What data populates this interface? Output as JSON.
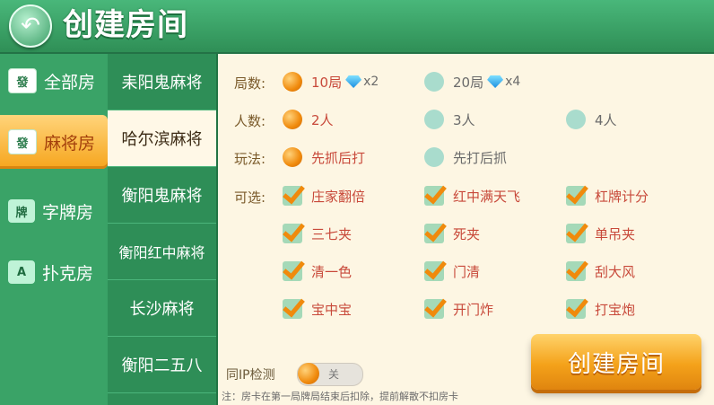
{
  "header": {
    "title": "创建房间",
    "back_icon": "back-arrow-icon"
  },
  "categories": [
    {
      "label": "全部房",
      "icon": "發",
      "active": false
    },
    {
      "label": "麻将房",
      "icon": "發",
      "active": true
    },
    {
      "label": "字牌房",
      "icon": "牌",
      "active": false
    },
    {
      "label": "扑克房",
      "icon": "A",
      "active": false
    }
  ],
  "games": [
    {
      "label": "耒阳鬼麻将",
      "active": false
    },
    {
      "label": "哈尔滨麻将",
      "active": true
    },
    {
      "label": "衡阳鬼麻将",
      "active": false
    },
    {
      "label": "衡阳红中麻将",
      "active": false
    },
    {
      "label": "长沙麻将",
      "active": false
    },
    {
      "label": "衡阳二五八",
      "active": false
    }
  ],
  "settings": {
    "rounds": {
      "label": "局数:",
      "options": [
        {
          "label": "10局",
          "cost": "x2",
          "selected": true
        },
        {
          "label": "20局",
          "cost": "x4",
          "selected": false
        }
      ]
    },
    "players": {
      "label": "人数:",
      "options": [
        {
          "label": "2人",
          "selected": true
        },
        {
          "label": "3人",
          "selected": false
        },
        {
          "label": "4人",
          "selected": false
        }
      ]
    },
    "play_mode": {
      "label": "玩法:",
      "options": [
        {
          "label": "先抓后打",
          "selected": true
        },
        {
          "label": "先打后抓",
          "selected": false
        }
      ]
    },
    "optional": {
      "label": "可选:",
      "items": [
        "庄家翻倍",
        "红中满天飞",
        "杠牌计分",
        "三七夹",
        "死夹",
        "单吊夹",
        "清一色",
        "门清",
        "刮大风",
        "宝中宝",
        "开门炸",
        "打宝炮"
      ]
    }
  },
  "ip_check": {
    "label": "同IP检测",
    "state": "关"
  },
  "note": "注：房卡在第一局牌局结束后扣除，提前解散不扣房卡",
  "create_button": "创建房间",
  "colors": {
    "accent_orange": "#f4a21a",
    "green": "#2f8f56",
    "panel_bg": "#fdf6e3",
    "option_text": "#c8493a"
  }
}
